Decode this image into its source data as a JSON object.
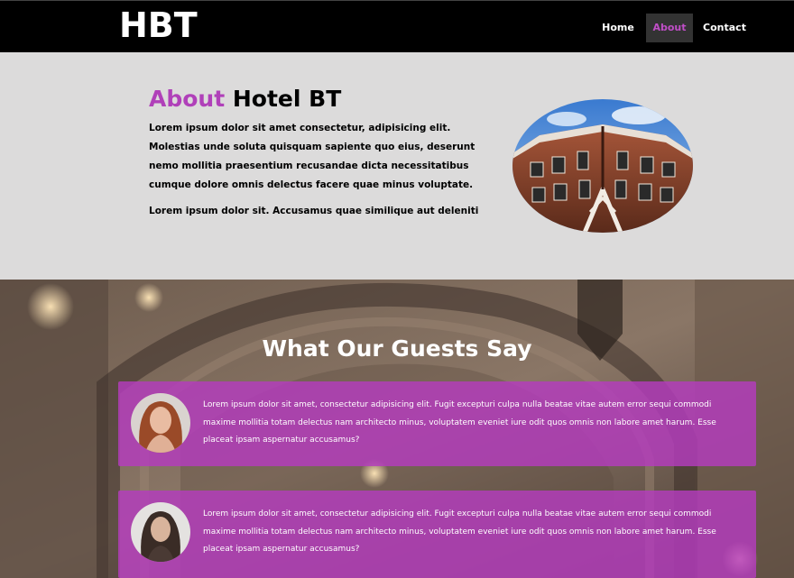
{
  "brand": {
    "logo": "HBT",
    "accent_color": "#b040b9"
  },
  "nav": {
    "items": [
      {
        "label": "Home",
        "active": false
      },
      {
        "label": "About",
        "active": true
      },
      {
        "label": "Contact",
        "active": false
      }
    ]
  },
  "about": {
    "title_accent": "About",
    "title_rest": " Hotel BT",
    "paragraph1": "Lorem ipsum dolor sit amet consectetur, adipisicing elit. Molestias unde soluta quisquam sapiente quo eius, deserunt nemo mollitia praesentium recusandae dicta necessitatibus cumque dolore omnis delectus facere quae minus voluptate.",
    "paragraph2": "Lorem ipsum dolor sit. Accusamus quae similique aut deleniti",
    "image": "hotel-building-photo"
  },
  "testimonials": {
    "title": "What Our Guests Say",
    "background_image": "archway-with-lights-photo",
    "items": [
      {
        "avatar": "woman-red-hair-photo",
        "text": "Lorem ipsum dolor sit amet, consectetur adipisicing elit. Fugit excepturi culpa nulla beatae vitae autem error sequi commodi maxime mollitia totam delectus nam architecto minus, voluptatem eveniet iure odit quos omnis non labore amet harum. Esse placeat ipsam aspernatur accusamus?"
      },
      {
        "avatar": "woman-dark-hair-photo",
        "text": "Lorem ipsum dolor sit amet, consectetur adipisicing elit. Fugit excepturi culpa nulla beatae vitae autem error sequi commodi maxime mollitia totam delectus nam architecto minus, voluptatem eveniet iure odit quos omnis non labore amet harum. Esse placeat ipsam aspernatur accusamus?"
      }
    ]
  }
}
